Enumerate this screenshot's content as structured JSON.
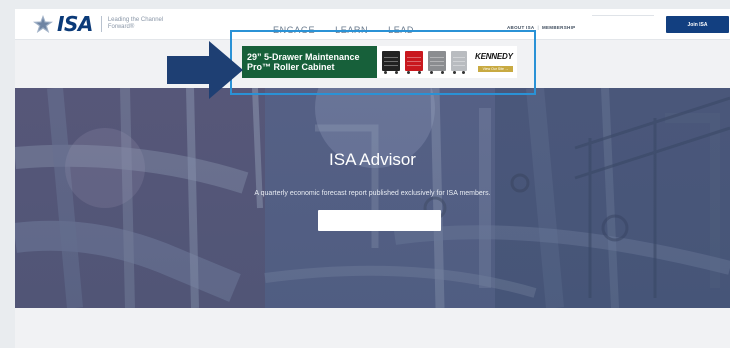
{
  "header": {
    "logo_text": "ISA",
    "tagline": "Leading the Channel Forward®",
    "nav": [
      "ENGAGE",
      "LEARN",
      "LEAD"
    ],
    "util_links": [
      "ABOUT ISA",
      "MEMBERSHIP"
    ],
    "util_separator": "|",
    "join_label": "Join ISA"
  },
  "ad": {
    "headline": "29” 5-Drawer Maintenance Pro™ Roller Cabinet",
    "brand": "KENNEDY",
    "cta": "View Our Site →",
    "colors": {
      "green": "#17603a",
      "gold": "#c8aa42",
      "frame": "#2a92d6",
      "arrow": "#1e3f73"
    }
  },
  "hero": {
    "title": "ISA Advisor",
    "subtitle": "A quarterly economic forecast report published exclusively for ISA members.",
    "button_label": ""
  },
  "colors": {
    "brand_navy": "#123f80",
    "page_bg": "#f1f2f4"
  }
}
